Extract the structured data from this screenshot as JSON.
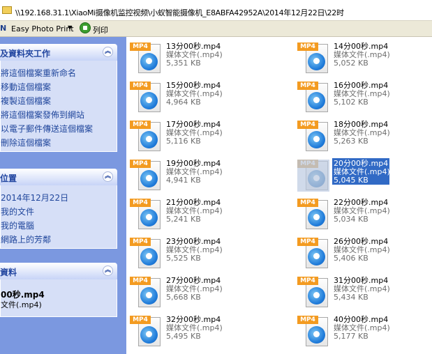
{
  "address_bar": {
    "path": "\\\\192.168.31.1\\XiaoMi摄像机监控视频\\小蚁智能摄像机_E8ABFA42952A\\2014年12月22日\\22时"
  },
  "toolbar": {
    "first_glyph": "N",
    "easy_photo_print": "Easy Photo Print",
    "dropdown": "▼",
    "print_label": "列印"
  },
  "sidebar": {
    "tasks": {
      "title": "及資料夾工作",
      "chevron": "︽",
      "items": [
        "將這個檔案重新命名",
        "移動這個檔案",
        "複製這個檔案",
        "將這個檔案發佈到網站",
        "以電子郵件傳送這個檔案",
        "刪除這個檔案"
      ]
    },
    "places": {
      "title": "位置",
      "chevron": "︽",
      "items": [
        "2014年12月22日",
        "我的文件",
        "我的電腦",
        "網路上的芳鄰"
      ]
    },
    "details": {
      "title": "資料",
      "chevron": "︽",
      "file_name": "00秒.mp4",
      "file_type": "文件(.mp4)"
    }
  },
  "files": [
    {
      "name": "13分00秒.mp4",
      "type": "媒体文件(.mp4)",
      "size": "5,351 KB",
      "badge": "MP4"
    },
    {
      "name": "14分00秒.mp4",
      "type": "媒体文件(.mp4)",
      "size": "5,052 KB",
      "badge": "MP4"
    },
    {
      "name": "15分00秒.mp4",
      "type": "媒体文件(.mp4)",
      "size": "4,964 KB",
      "badge": "MP4"
    },
    {
      "name": "16分00秒.mp4",
      "type": "媒体文件(.mp4)",
      "size": "5,102 KB",
      "badge": "MP4"
    },
    {
      "name": "17分00秒.mp4",
      "type": "媒体文件(.mp4)",
      "size": "5,116 KB",
      "badge": "MP4"
    },
    {
      "name": "18分00秒.mp4",
      "type": "媒体文件(.mp4)",
      "size": "5,263 KB",
      "badge": "MP4"
    },
    {
      "name": "19分00秒.mp4",
      "type": "媒体文件(.mp4)",
      "size": "4,941 KB",
      "badge": "MP4"
    },
    {
      "name": "20分00秒.mp4",
      "type": "媒体文件(.mp4)",
      "size": "5,045 KB",
      "badge": "MP4",
      "selected": true
    },
    {
      "name": "21分00秒.mp4",
      "type": "媒体文件(.mp4)",
      "size": "5,241 KB",
      "badge": "MP4"
    },
    {
      "name": "22分00秒.mp4",
      "type": "媒体文件(.mp4)",
      "size": "5,034 KB",
      "badge": "MP4"
    },
    {
      "name": "23分00秒.mp4",
      "type": "媒体文件(.mp4)",
      "size": "5,525 KB",
      "badge": "MP4"
    },
    {
      "name": "26分00秒.mp4",
      "type": "媒体文件(.mp4)",
      "size": "5,406 KB",
      "badge": "MP4"
    },
    {
      "name": "27分00秒.mp4",
      "type": "媒体文件(.mp4)",
      "size": "5,668 KB",
      "badge": "MP4"
    },
    {
      "name": "31分00秒.mp4",
      "type": "媒体文件(.mp4)",
      "size": "5,434 KB",
      "badge": "MP4"
    },
    {
      "name": "32分00秒.mp4",
      "type": "媒体文件(.mp4)",
      "size": "5,495 KB",
      "badge": "MP4"
    },
    {
      "name": "40分00秒.mp4",
      "type": "媒体文件(.mp4)",
      "size": "5,177 KB",
      "badge": "MP4"
    }
  ],
  "colors": {
    "sidebar_bg": "#7b98e0",
    "panel_bg": "#d6dff7",
    "link": "#21479c",
    "selection": "#316ac5",
    "badge": "#f39b21"
  }
}
